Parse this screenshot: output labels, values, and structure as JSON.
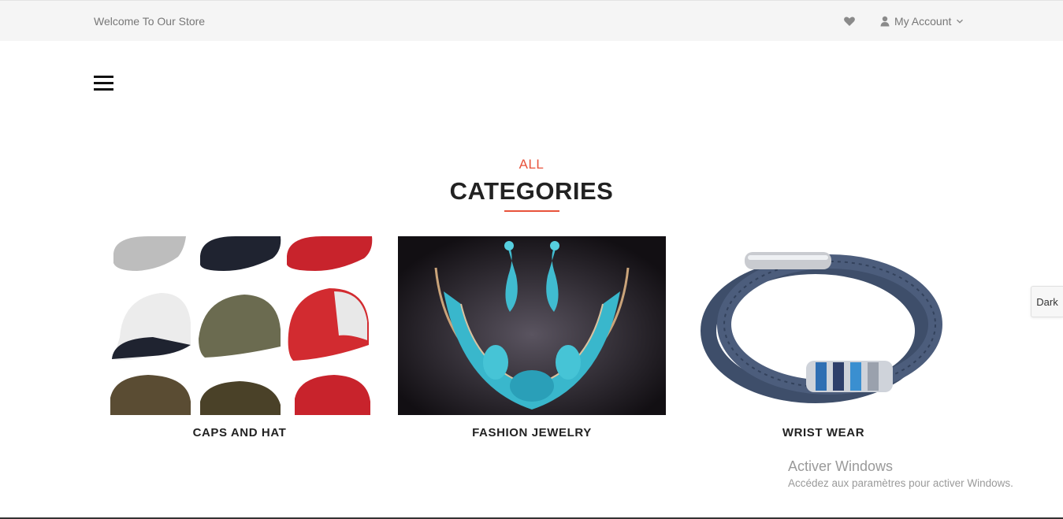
{
  "topbar": {
    "welcome": "Welcome To Our Store",
    "wishlist_icon": "heart-icon",
    "account_icon": "user-icon",
    "account_label": "My Account",
    "account_chevron": "chevron-down-icon"
  },
  "menu": {
    "icon": "hamburger-menu-icon"
  },
  "section": {
    "subtitle": "ALL",
    "title": "CATEGORIES",
    "accent_color": "#e8533b"
  },
  "categories": [
    {
      "label": "CAPS AND HAT",
      "image": "caps-grid-photo"
    },
    {
      "label": "FASHION JEWELRY",
      "image": "necklace-earrings-photo"
    },
    {
      "label": "WRIST WEAR",
      "image": "leather-bracelet-photo"
    }
  ],
  "dark_toggle": {
    "label": "Dark"
  },
  "windows_watermark": {
    "title": "Activer Windows",
    "subtitle": "Accédez aux paramètres pour activer Windows."
  }
}
